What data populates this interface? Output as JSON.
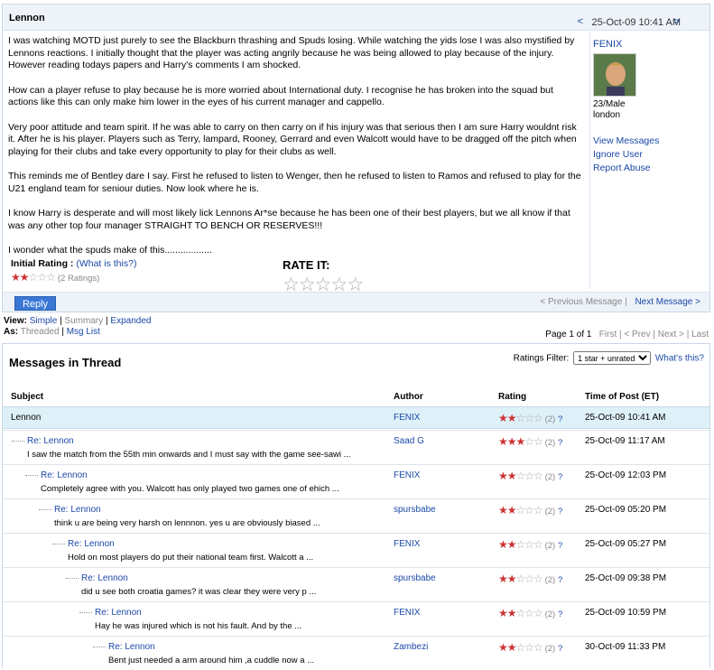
{
  "post": {
    "title": "Lennon",
    "date": "25-Oct-09 10:41 AM",
    "prev_arrow": "<",
    "next_arrow": ">",
    "paragraphs": [
      "I was watching MOTD just purely to see the Blackburn thrashing and Spuds losing. While watching the yids lose I was also mystified by Lennons reactions. I initially thought that the player was acting angrily because he was being allowed to play because of the injury. However reading todays papers and Harry's comments I am shocked.",
      "How can a player refuse to play because he is more worried about International duty. I recognise he has broken into the squad but actions like this can only make him lower in the eyes of his current manager and cappello.",
      "Very poor attitude and team spirit. If he was able to carry on then carry on if his injury was that serious then I am sure Harry wouldnt risk it. After he is his player. Players such as Terry, lampard, Rooney, Gerrard and even Walcott would have to be dragged off the pitch when playing for their clubs and take every opportunity to play for their clubs as well.",
      "This reminds me of Bentley dare I say. First he refused to listen to Wenger, then he refused to listen to Ramos and refused to play for the U21 england team for seniour duties. Now look where he is.",
      "I know Harry is desperate and will most likely lick Lennons Ar*se because he has been one of their best players, but we all know if that was any other top four manager STRAIGHT TO BENCH OR RESERVES!!!",
      "I wonder what the spuds make of this.................."
    ],
    "initial_rating_label": "Initial Rating :",
    "what_is_this": "(What is this?)",
    "rating_count": "(2 Ratings)",
    "rate_it_label": "RATE IT:",
    "author": "FENIX",
    "author_meta_1": "23/Male",
    "author_meta_2": "london",
    "view_messages": "View Messages",
    "ignore_user": "Ignore User",
    "report_abuse": "Report Abuse",
    "reply": "Reply",
    "prev_message": "< Previous Message",
    "sep": "|",
    "next_message": "Next Message >"
  },
  "viewbar": {
    "view_label": "View:",
    "simple": "Simple",
    "summary": "Summary",
    "expanded": "Expanded",
    "as_label": "As:",
    "threaded": "Threaded",
    "msg_list": "Msg List"
  },
  "pager": {
    "page": "Page 1 of 1",
    "first": "First",
    "prev": "< Prev",
    "next": "Next >",
    "last": "Last"
  },
  "thread": {
    "title": "Messages in Thread",
    "filter_label": "Ratings Filter:",
    "filter_value": "1 star + unrated",
    "whats_this": "What's this?",
    "columns": {
      "subject": "Subject",
      "author": "Author",
      "rating": "Rating",
      "time": "Time of Post (ET)"
    },
    "rows": [
      {
        "subject": "Lennon",
        "snippet": "",
        "author": "FENIX",
        "count": "(2)",
        "q": "?",
        "time": "25-Oct-09 10:41 AM",
        "stars": 2
      },
      {
        "subject": "Re: Lennon",
        "snippet": "I saw the match from the 55th min onwards and I must say with the game see-sawi ...",
        "author": "Saad G",
        "count": "(2)",
        "q": "?",
        "time": "25-Oct-09 11:17 AM",
        "stars": 3
      },
      {
        "subject": "Re: Lennon",
        "snippet": "Completely agree with you. Walcott has only played two games one of ehich ...",
        "author": "FENIX",
        "count": "(2)",
        "q": "?",
        "time": "25-Oct-09 12:03 PM",
        "stars": 2
      },
      {
        "subject": "Re: Lennon",
        "snippet": "think u are being very harsh on lennnon. yes u are obviously biased ...",
        "author": "spursbabe",
        "count": "(2)",
        "q": "?",
        "time": "25-Oct-09 05:20 PM",
        "stars": 2
      },
      {
        "subject": "Re: Lennon",
        "snippet": "Hold on most players do put their national team first. Walcott a ...",
        "author": "FENIX",
        "count": "(2)",
        "q": "?",
        "time": "25-Oct-09 05:27 PM",
        "stars": 2
      },
      {
        "subject": "Re: Lennon",
        "snippet": "did u see both croatia games? it was clear they were very p ...",
        "author": "spursbabe",
        "count": "(2)",
        "q": "?",
        "time": "25-Oct-09 09:38 PM",
        "stars": 2
      },
      {
        "subject": "Re: Lennon",
        "snippet": "Hay he was injured which is not his fault. And by the ...",
        "author": "FENIX",
        "count": "(2)",
        "q": "?",
        "time": "25-Oct-09 10:59 PM",
        "stars": 2
      },
      {
        "subject": "Re: Lennon",
        "snippet": "Bent just needed a arm around him ,a cuddle now a ...",
        "author": "Zambezi",
        "count": "(2)",
        "q": "?",
        "time": "30-Oct-09 11:33 PM",
        "stars": 2
      }
    ]
  }
}
